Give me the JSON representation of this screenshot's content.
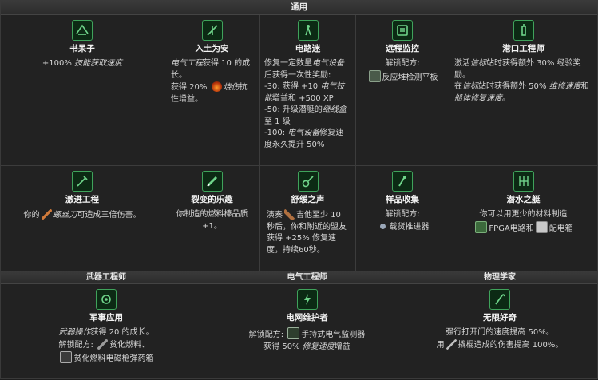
{
  "header": {
    "title": "通用"
  },
  "row1": [
    {
      "title": "书呆子",
      "icon": "book-icon",
      "lines": [
        [
          "+100% ",
          "技能获取速度"
        ]
      ]
    },
    {
      "title": "入土为安",
      "icon": "grave-icon"
    },
    {
      "title": "电路迷",
      "icon": "circuit-icon"
    },
    {
      "title": "远程监控",
      "icon": "tablet-icon"
    },
    {
      "title": "港口工程师",
      "icon": "beacon-icon"
    }
  ],
  "cell_ruturan": {
    "p1_em": "电气工程",
    "p1_rest": "获得 10 的成长。",
    "p2_a": "获得 20%",
    "p2_em": "烧伤",
    "p2_b": "抗性增益。"
  },
  "cell_circuit": {
    "l1_a": "修复一定数量",
    "l1_em": "电气设备",
    "l2": "后获得一次性奖励:",
    "l3_a": "-30: 获得 +10 ",
    "l3_em": "电气技能",
    "l3_b": "增益和 +500 XP",
    "l4_a": "-50: 升级潜艇的",
    "l4_em": "继线盒",
    "l4_b": "至 1 级",
    "l5_a": "-100: ",
    "l5_em": "电气设备",
    "l5_b": "修复速度永久提升 50%"
  },
  "cell_remote": {
    "unlock": "解锁配方:",
    "item": "反应堆检测平板"
  },
  "cell_port": {
    "l1_a": "激活",
    "l1_em": "信标",
    "l1_b": "站时获得额外 30% 经验奖励。",
    "l2_a": "在",
    "l2_em": "信标",
    "l2_b": "站时获得额外 50% ",
    "l2_em2": "维修速度",
    "l2_c": "和",
    "l2_em3": "船体修复速度",
    "l2_d": "。"
  },
  "row2": [
    {
      "title": "激进工程",
      "icon": "screwdriver-icon"
    },
    {
      "title": "裂变的乐趣",
      "icon": "fuel-rod-icon"
    },
    {
      "title": "舒缓之声",
      "icon": "guitar-icon"
    },
    {
      "title": "样品收集",
      "icon": "sample-icon"
    },
    {
      "title": "潜水之艇",
      "icon": "submarine-icon"
    }
  ],
  "cell_radical": {
    "a": "你的",
    "em": "螺丝刀",
    "b": "可造成三倍伤害。"
  },
  "cell_fission": {
    "text": "你制造的燃料棒品质 +1。"
  },
  "cell_sound": {
    "a": "演奏",
    "b": "吉他至少 10 秒后，你和附近的盟友获得 +25% 修复速度，持续60秒。"
  },
  "cell_sample": {
    "unlock": "解锁配方:",
    "item": "载货推进器"
  },
  "cell_sub": {
    "l1": "你可以用更少的材料制造",
    "item1": "FPGA电路",
    "and": "和",
    "item2": "配电箱"
  },
  "subheaders": [
    "武器工程师",
    "电气工程师",
    "物理学家"
  ],
  "row3": [
    {
      "title": "军事应用",
      "icon": "military-gear-icon"
    },
    {
      "title": "电网维护者",
      "icon": "lightning-icon"
    },
    {
      "title": "无限好奇",
      "icon": "crowbar-icon"
    }
  ],
  "cell_military": {
    "em": "武器操作",
    "l1": "获得 20 的成长。",
    "unlock": "解锁配方:",
    "item1": "贫化燃料、",
    "item2": "贫化燃料电磁枪弹药箱"
  },
  "cell_grid": {
    "unlock": "解锁配方:",
    "item": "手持式电气监测器",
    "l2_a": "获得 50% ",
    "l2_em": "修复速度",
    "l2_b": "增益"
  },
  "cell_curious": {
    "l1": "强行打开门的速度提高 50%。",
    "l2_a": "用",
    "l2_b": "撬棍造成的伤害提高 100%。"
  },
  "colors": {
    "accent_green": "#3fa35b",
    "icon_bg": "#0c2a14",
    "header_bg": "#333333"
  }
}
